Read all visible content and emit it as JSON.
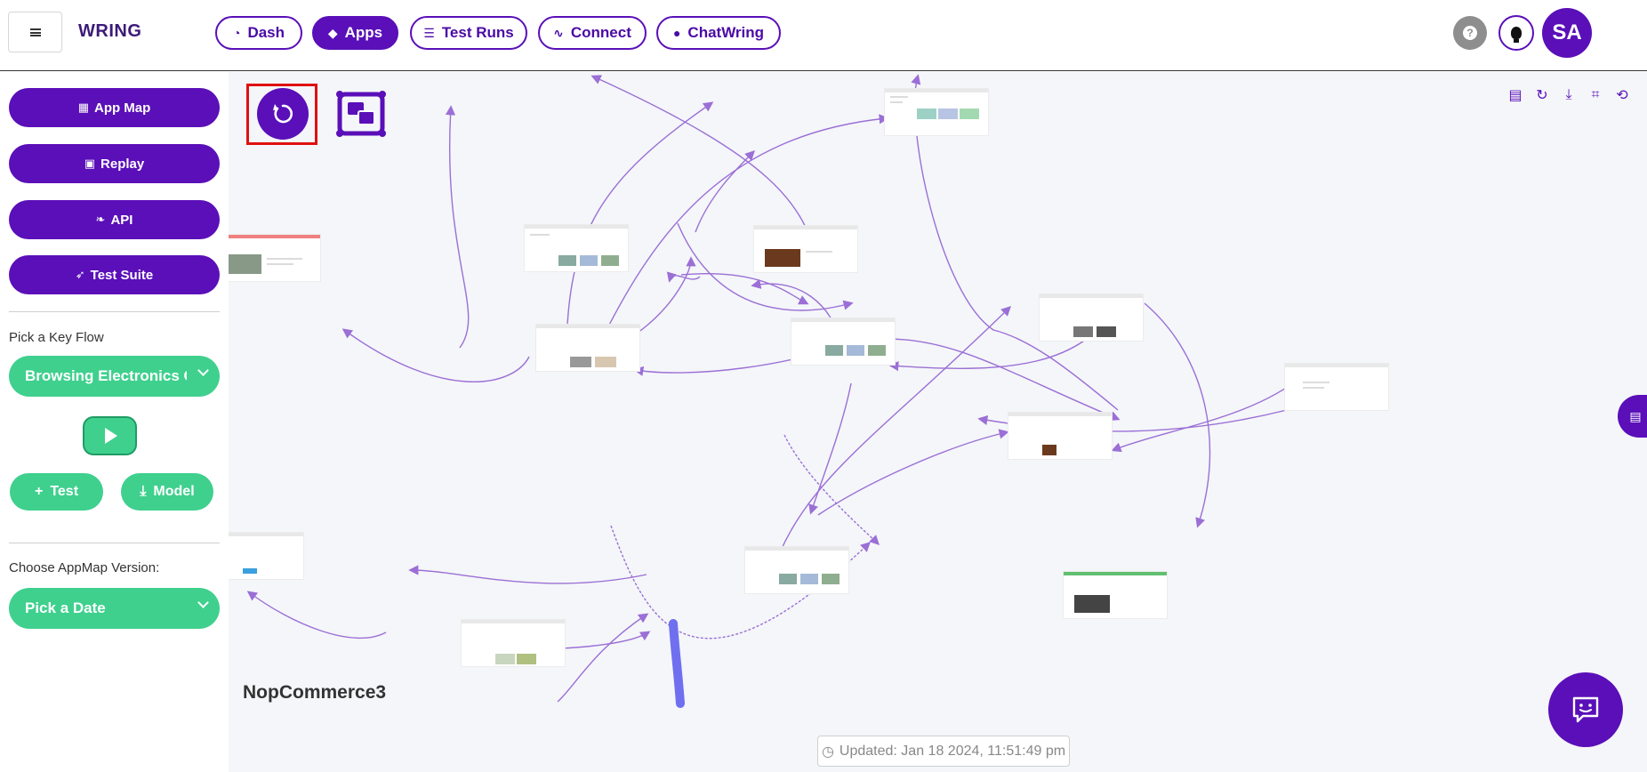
{
  "app": {
    "brand": "WRING"
  },
  "nav": {
    "items": [
      {
        "label": "Dash",
        "icon": "pie-chart-icon"
      },
      {
        "label": "Apps",
        "icon": "cube-icon",
        "active": true
      },
      {
        "label": "Test Runs",
        "icon": "list-icon"
      },
      {
        "label": "Connect",
        "icon": "pulse-icon"
      },
      {
        "label": "ChatWring",
        "icon": "chat-bubble-icon"
      }
    ]
  },
  "header_right": {
    "help": "?",
    "avatar": "SA"
  },
  "sidebar": {
    "buttons": [
      {
        "label": "App Map",
        "icon": "map-icon"
      },
      {
        "label": "Replay",
        "icon": "film-icon"
      },
      {
        "label": "API",
        "icon": "leaf-icon"
      },
      {
        "label": "Test Suite",
        "icon": "rocket-icon"
      }
    ],
    "key_flow_label": "Pick a Key Flow",
    "key_flow_value": "Browsing Electronics Ca",
    "test_button": "Test",
    "model_button": "Model",
    "version_label": "Choose AppMap Version:",
    "version_value": "Pick a Date"
  },
  "canvas": {
    "app_name": "NopCommerce3",
    "updated": "Updated: Jan 18 2024, 11:51:49 pm",
    "toolbar_icons": [
      "document-icon",
      "refresh-icon",
      "download-icon",
      "crop-icon",
      "rotate-icon"
    ]
  },
  "colors": {
    "primary": "#5a0fb8",
    "accent_green": "#3fd08e",
    "edge": "#9b6fd6",
    "highlight": "#e01010"
  }
}
